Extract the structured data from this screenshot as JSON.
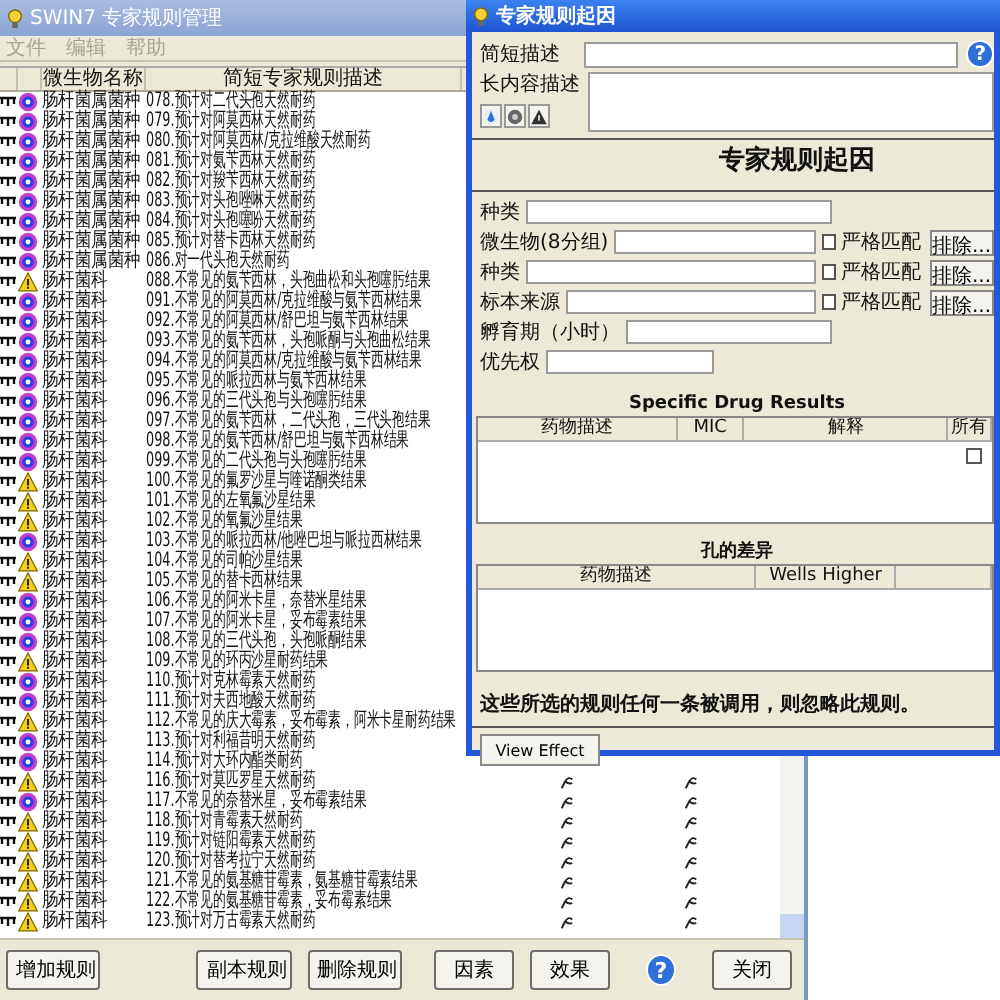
{
  "main_window": {
    "title": "SWIN7 专家规则管理",
    "menu": [
      {
        "label": "文件",
        "disabled": true
      },
      {
        "label": "编辑",
        "disabled": true
      },
      {
        "label": "帮助",
        "disabled": true
      }
    ],
    "columns": [
      "微生物名称",
      "简短专家规则描述"
    ],
    "rows": [
      {
        "kind": "info",
        "organism": "肠杆菌属菌种",
        "description": "078.预计对二代头孢天然耐药",
        "effect_icons": false
      },
      {
        "kind": "info",
        "organism": "肠杆菌属菌种",
        "description": "079.预计对阿莫西林天然耐药",
        "effect_icons": false
      },
      {
        "kind": "info",
        "organism": "肠杆菌属菌种",
        "description": "080.预计对阿莫西林/克拉维酸天然耐药",
        "effect_icons": false
      },
      {
        "kind": "info",
        "organism": "肠杆菌属菌种",
        "description": "081.预计对氨苄西林天然耐药",
        "effect_icons": false
      },
      {
        "kind": "info",
        "organism": "肠杆菌属菌种",
        "description": "082.预计对羧苄西林天然耐药",
        "effect_icons": false
      },
      {
        "kind": "info",
        "organism": "肠杆菌属菌种",
        "description": "083.预计对头孢唑啉天然耐药",
        "effect_icons": false
      },
      {
        "kind": "info",
        "organism": "肠杆菌属菌种",
        "description": "084.预计对头孢噻吩天然耐药",
        "effect_icons": false
      },
      {
        "kind": "info",
        "organism": "肠杆菌属菌种",
        "description": "085.预计对替卡西林天然耐药",
        "effect_icons": false
      },
      {
        "kind": "info",
        "organism": "肠杆菌属菌种",
        "description": "086.对一代头孢天然耐药",
        "effect_icons": false
      },
      {
        "kind": "warning",
        "organism": "肠杆菌科",
        "description": "088.不常见的氨苄西林，头孢曲松和头孢噻肟结果",
        "effect_icons": false
      },
      {
        "kind": "info",
        "organism": "肠杆菌科",
        "description": "091.不常见的阿莫西林/克拉维酸与氨苄西林结果",
        "effect_icons": false
      },
      {
        "kind": "info",
        "organism": "肠杆菌科",
        "description": "092.不常见的阿莫西林/舒巴坦与氨苄西林结果",
        "effect_icons": false
      },
      {
        "kind": "info",
        "organism": "肠杆菌科",
        "description": "093.不常见的氨苄西林，头孢哌酮与头孢曲松结果",
        "effect_icons": false
      },
      {
        "kind": "info",
        "organism": "肠杆菌科",
        "description": "094.不常见的阿莫西林/克拉维酸与氨苄西林结果",
        "effect_icons": false
      },
      {
        "kind": "info",
        "organism": "肠杆菌科",
        "description": "095.不常见的哌拉西林与氨苄西林结果",
        "effect_icons": false
      },
      {
        "kind": "info",
        "organism": "肠杆菌科",
        "description": "096.不常见的三代头孢与头孢噻肟结果",
        "effect_icons": false
      },
      {
        "kind": "info",
        "organism": "肠杆菌科",
        "description": "097.不常见的氨苄西林，二代头孢，三代头孢结果",
        "effect_icons": false
      },
      {
        "kind": "info",
        "organism": "肠杆菌科",
        "description": "098.不常见的氨苄西林/舒巴坦与氨苄西林结果",
        "effect_icons": false
      },
      {
        "kind": "info",
        "organism": "肠杆菌科",
        "description": "099.不常见的二代头孢与头孢噻肟结果",
        "effect_icons": false
      },
      {
        "kind": "warning",
        "organism": "肠杆菌科",
        "description": "100.不常见的氟罗沙星与喹诺酮类结果",
        "effect_icons": false
      },
      {
        "kind": "warning",
        "organism": "肠杆菌科",
        "description": "101.不常见的左氧氟沙星结果",
        "effect_icons": false
      },
      {
        "kind": "warning",
        "organism": "肠杆菌科",
        "description": "102.不常见的氧氟沙星结果",
        "effect_icons": false
      },
      {
        "kind": "info",
        "organism": "肠杆菌科",
        "description": "103.不常见的哌拉西林/他唑巴坦与哌拉西林结果",
        "effect_icons": false
      },
      {
        "kind": "warning",
        "organism": "肠杆菌科",
        "description": "104.不常见的司帕沙星结果",
        "effect_icons": false
      },
      {
        "kind": "warning",
        "organism": "肠杆菌科",
        "description": "105.不常见的替卡西林结果",
        "effect_icons": false
      },
      {
        "kind": "info",
        "organism": "肠杆菌科",
        "description": "106.不常见的阿米卡星，奈替米星结果",
        "effect_icons": false
      },
      {
        "kind": "info",
        "organism": "肠杆菌科",
        "description": "107.不常见的阿米卡星，妥布霉素结果",
        "effect_icons": false
      },
      {
        "kind": "info",
        "organism": "肠杆菌科",
        "description": "108.不常见的三代头孢，头孢哌酮结果",
        "effect_icons": false
      },
      {
        "kind": "warning",
        "organism": "肠杆菌科",
        "description": "109.不常见的环丙沙星耐药结果",
        "effect_icons": false
      },
      {
        "kind": "info",
        "organism": "肠杆菌科",
        "description": "110.预计对克林霉素天然耐药",
        "effect_icons": false
      },
      {
        "kind": "info",
        "organism": "肠杆菌科",
        "description": "111.预计对夫西地酸天然耐药",
        "effect_icons": false
      },
      {
        "kind": "warning",
        "organism": "肠杆菌科",
        "description": "112.不常见的庆大霉素，妥布霉素，阿米卡星耐药结果",
        "effect_icons": false
      },
      {
        "kind": "info",
        "organism": "肠杆菌科",
        "description": "113.预计对利福昔明天然耐药",
        "effect_icons": false
      },
      {
        "kind": "info",
        "organism": "肠杆菌科",
        "description": "114.预计对大环内酯类耐药",
        "effect_icons": false
      },
      {
        "kind": "warning",
        "organism": "肠杆菌科",
        "description": "116.预计对莫匹罗星天然耐药",
        "effect_icons": true
      },
      {
        "kind": "info",
        "organism": "肠杆菌科",
        "description": "117.不常见的奈替米星，妥布霉素结果",
        "effect_icons": true
      },
      {
        "kind": "warning",
        "organism": "肠杆菌科",
        "description": "118.预计对青霉素天然耐药",
        "effect_icons": true
      },
      {
        "kind": "warning",
        "organism": "肠杆菌科",
        "description": "119.预计对链阳霉素天然耐药",
        "effect_icons": true
      },
      {
        "kind": "warning",
        "organism": "肠杆菌科",
        "description": "120.预计对替考拉宁天然耐药",
        "effect_icons": true
      },
      {
        "kind": "warning",
        "organism": "肠杆菌科",
        "description": "121.不常见的氨基糖苷霉素，氨基糖苷霉素结果",
        "effect_icons": true
      },
      {
        "kind": "warning",
        "organism": "肠杆菌科",
        "description": "122.不常见的氨基糖苷霉素，妥布霉素结果",
        "effect_icons": true
      },
      {
        "kind": "warning",
        "organism": "肠杆菌科",
        "description": "123.预计对万古霉素天然耐药",
        "effect_icons": true
      }
    ],
    "buttons_left": [
      "增加规则",
      "副本规则",
      "删除规则"
    ],
    "buttons_right": [
      "因素",
      "效果"
    ],
    "help_label": "?",
    "close_button": "关闭"
  },
  "dialog": {
    "title": "专家规则起因",
    "short_desc_label": "简短描述",
    "long_desc_label": "长内容描述",
    "help_label": "?",
    "heading": "专家规则起因",
    "fields": [
      {
        "kind": "plain",
        "label": "种类"
      },
      {
        "kind": "match",
        "label": "微生物(8分组)",
        "checkbox_label": "严格匹配",
        "checked": false,
        "button": "排除..."
      },
      {
        "kind": "match",
        "label": "种类",
        "checkbox_label": "严格匹配",
        "checked": false,
        "button": "排除..."
      },
      {
        "kind": "match",
        "label": "标本来源",
        "checkbox_label": "严格匹配",
        "checked": false,
        "button": "排除..."
      },
      {
        "kind": "plain",
        "label": "孵育期（小时）"
      },
      {
        "kind": "short",
        "label": "优先权"
      }
    ],
    "drug_results": {
      "title": "Specific Drug Results",
      "columns": [
        "药物描述",
        "MIC",
        "解释",
        "所有"
      ],
      "checked": false
    },
    "wells": {
      "title": "孔的差异",
      "columns": [
        "药物描述",
        "Wells Higher"
      ]
    },
    "note": "这些所选的规则任何一条被调用，则忽略此规则。",
    "view_effect": "View Effect"
  }
}
